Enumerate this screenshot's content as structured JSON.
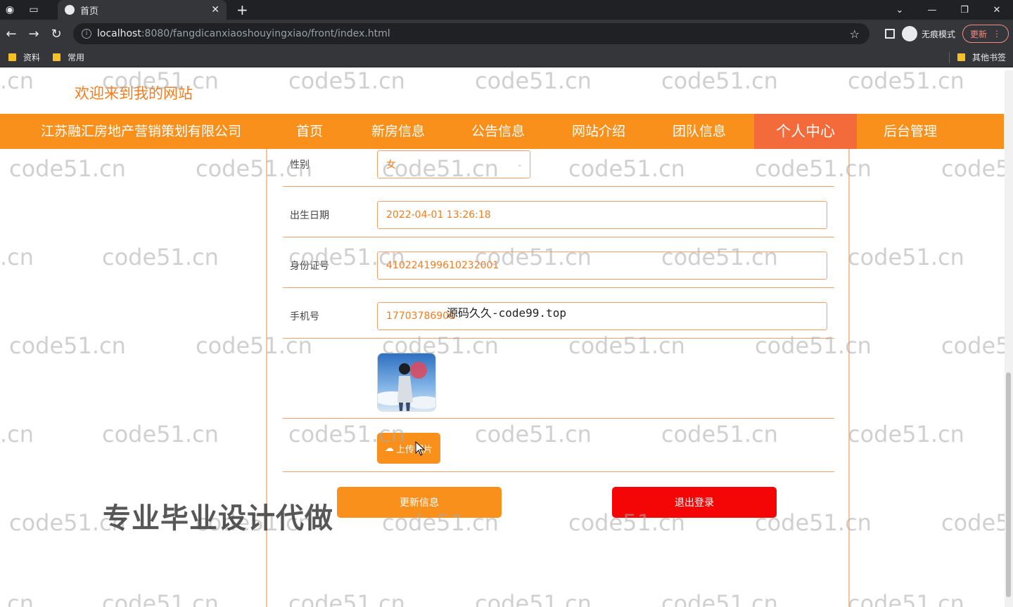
{
  "browser": {
    "tab_title": "首页",
    "url_host": "localhost",
    "url_path": ":8080/fangdicanxiaoshouyingxiao/front/index.html",
    "incognito_label": "无痕模式",
    "update_label": "更新",
    "bookmarks": [
      "资料",
      "常用"
    ],
    "other_bookmarks": "其他书签"
  },
  "header": {
    "welcome": "欢迎来到我的网站"
  },
  "nav": {
    "brand": "江苏融汇房地产营销策划有限公司",
    "items": [
      "首页",
      "新房信息",
      "公告信息",
      "网站介绍",
      "团队信息",
      "个人中心",
      "后台管理"
    ],
    "active": "个人中心"
  },
  "form": {
    "gender_label": "性别",
    "gender_value": "女",
    "birth_label": "出生日期",
    "birth_value": "2022-04-01 13:26:18",
    "id_label": "身份证号",
    "id_value": "410224199610232001",
    "phone_label": "手机号",
    "phone_value": "17703786901",
    "upload_label": "上传照片",
    "update_button": "更新信息",
    "logout_button": "退出登录"
  },
  "overlays": {
    "watermark": "code51.cn",
    "watermark_left_fragment": ".cn",
    "watermark_right_fragment": "code5",
    "promo": "专业毕业设计代做",
    "source_text": "源码久久-code99.top"
  },
  "colors": {
    "nav_bg": "#fa901c",
    "nav_active": "#f36b3b",
    "accent": "#f47c1c",
    "logout": "#f50606"
  }
}
